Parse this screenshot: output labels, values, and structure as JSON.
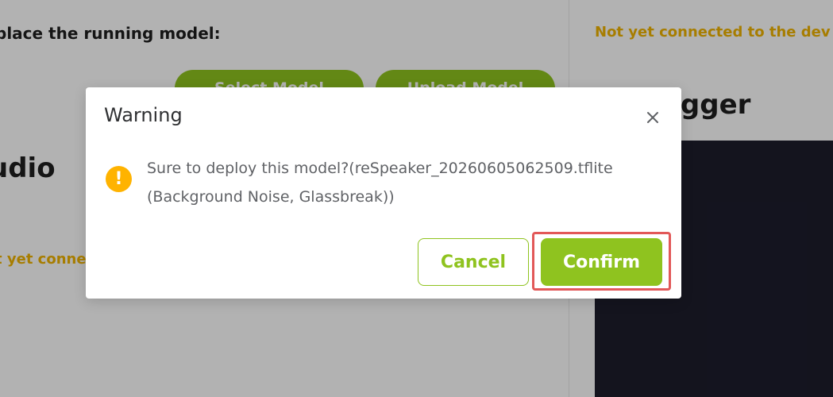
{
  "background": {
    "replace_heading": "place the running model:",
    "select_model_label": "Select Model",
    "upload_model_label": "Upload Model",
    "audio_heading": "udio",
    "left_status": "t yet conne",
    "right_status": "Not yet connected to the dev",
    "logger_heading": "e Logger"
  },
  "dialog": {
    "title": "Warning",
    "message": "Sure to deploy this model?(reSpeaker_20260605062509.tflite (Background Noise, Glassbreak))",
    "cancel_label": "Cancel",
    "confirm_label": "Confirm",
    "warning_icon_glyph": "!",
    "close_icon": "close-icon",
    "warning_icon": "warning-icon"
  },
  "colors": {
    "accent": "#8fc31f",
    "warning": "#ffb300",
    "status": "#f0b400",
    "highlight": "#e25858",
    "console": "#1d1d2c"
  }
}
